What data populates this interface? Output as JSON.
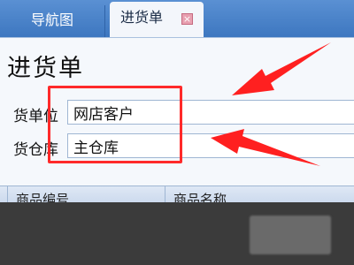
{
  "tabs": [
    {
      "label": "导航图",
      "active": false
    },
    {
      "label": "进货单",
      "active": true
    }
  ],
  "form": {
    "title": "进货单",
    "supplier_label": "货单位",
    "supplier_value": "网店客户",
    "warehouse_label": "货仓库",
    "warehouse_value": "主仓库"
  },
  "grid": {
    "columns": [
      "商品编号",
      "商品名称"
    ]
  },
  "colors": {
    "tab_bar": "#4a84cb",
    "panel_bg": "#f5f8fc",
    "highlight": "#ff2a2a",
    "overlay": "#3b3b3b"
  }
}
